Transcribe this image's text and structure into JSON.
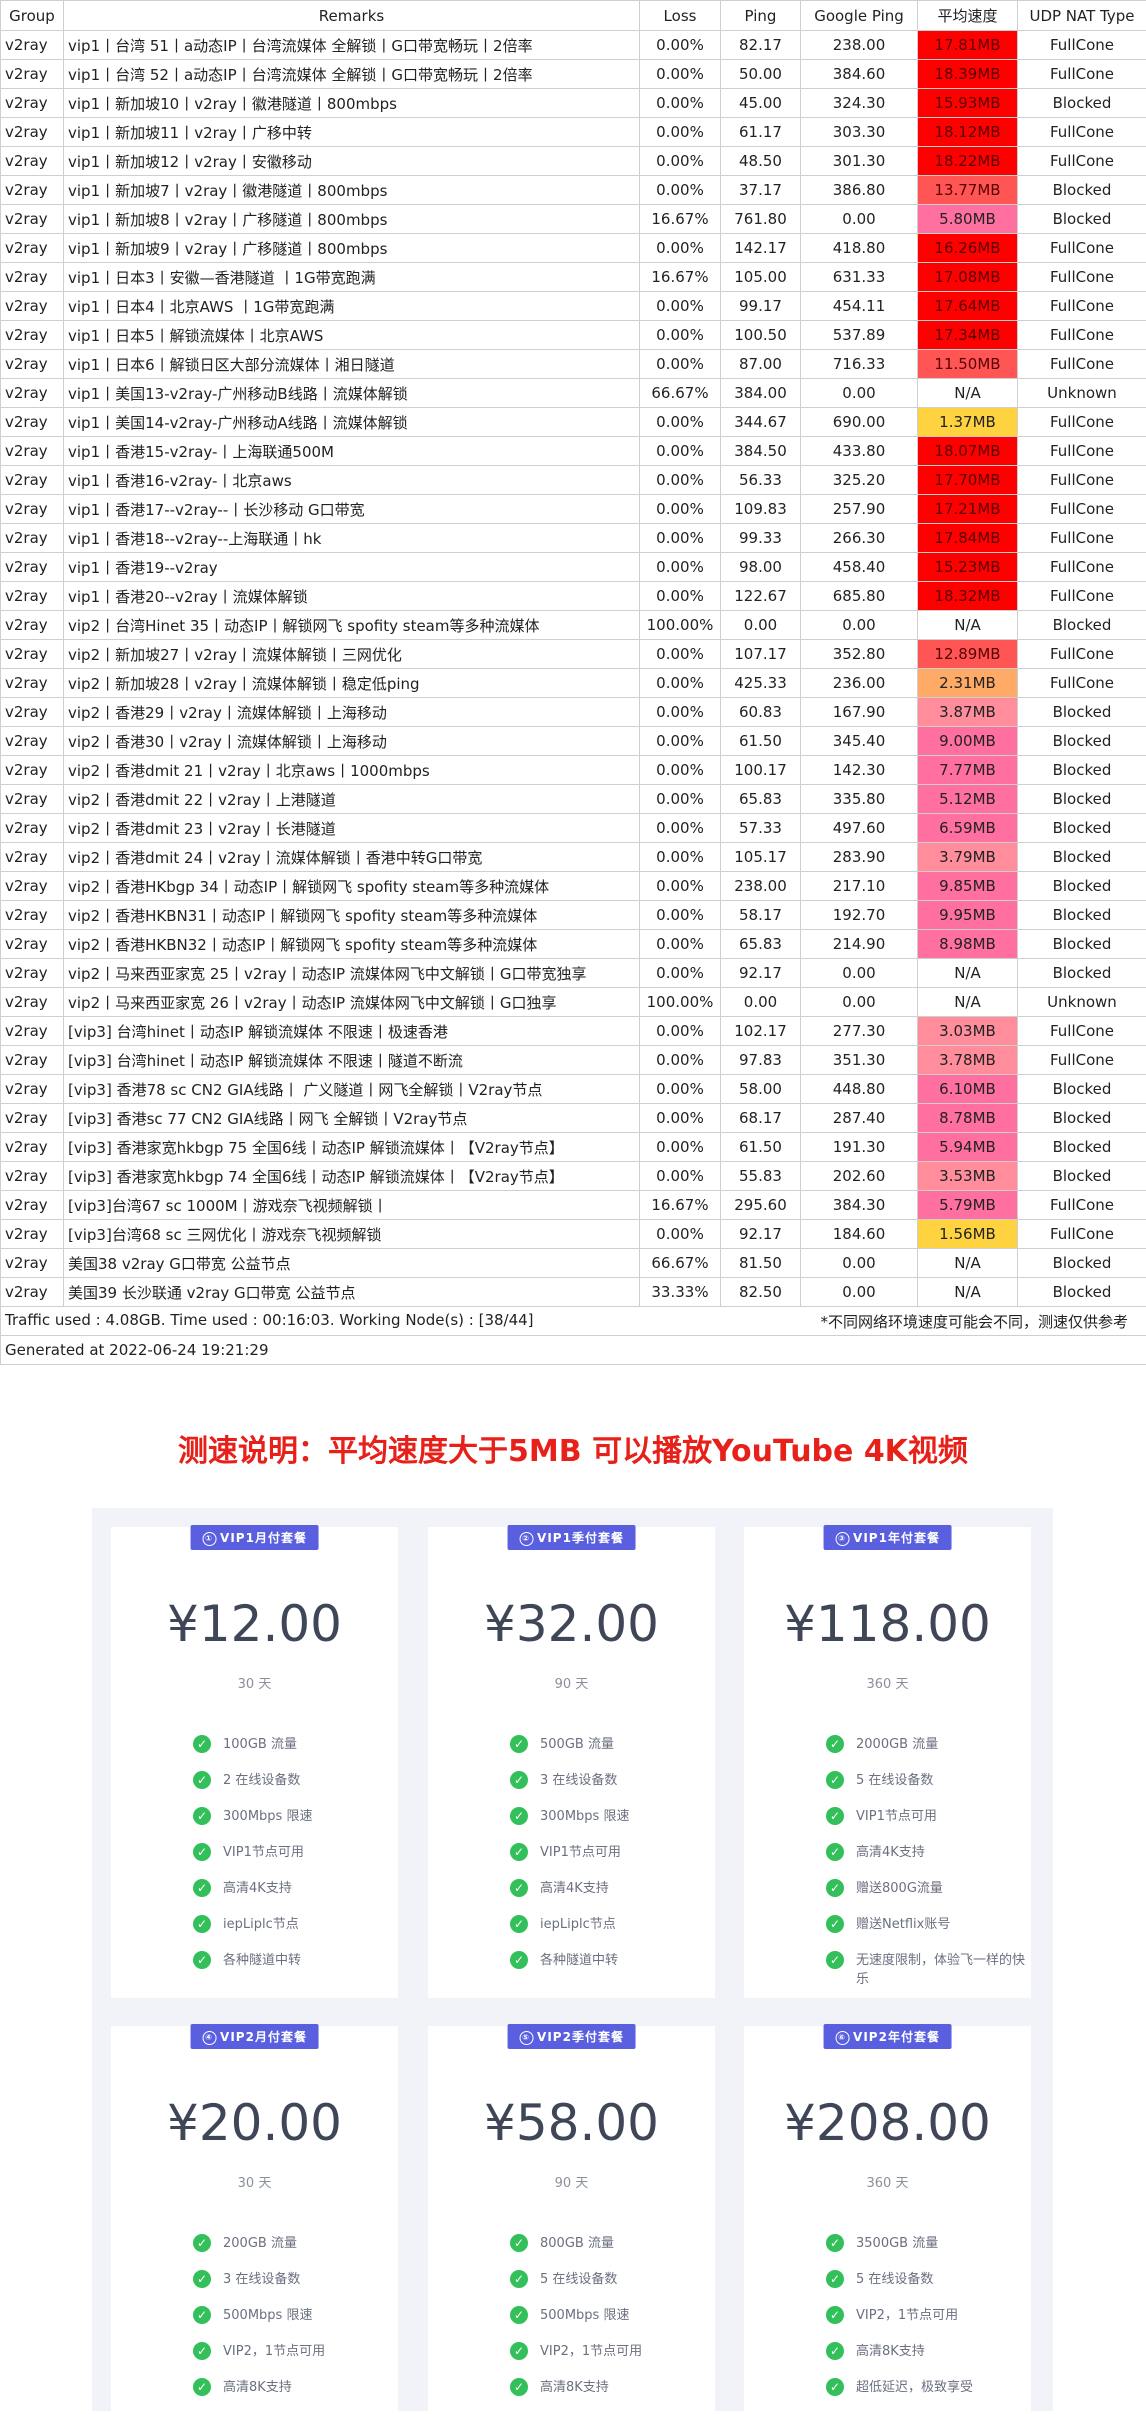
{
  "table": {
    "headers": [
      "Group",
      "Remarks",
      "Loss",
      "Ping",
      "Google Ping",
      "平均速度",
      "UDP NAT Type"
    ],
    "rows": [
      [
        "v2ray",
        "vip1丨台湾 51丨a动态IP丨台湾流媒体 全解锁丨G口带宽畅玩丨2倍率",
        "0.00%",
        "82.17",
        "238.00",
        "17.81MB",
        "FullCone"
      ],
      [
        "v2ray",
        "vip1丨台湾 52丨a动态IP丨台湾流媒体 全解锁丨G口带宽畅玩丨2倍率",
        "0.00%",
        "50.00",
        "384.60",
        "18.39MB",
        "FullCone"
      ],
      [
        "v2ray",
        "vip1丨新加坡10丨v2ray丨徽港隧道丨800mbps",
        "0.00%",
        "45.00",
        "324.30",
        "15.93MB",
        "Blocked"
      ],
      [
        "v2ray",
        "vip1丨新加坡11丨v2ray丨广移中转",
        "0.00%",
        "61.17",
        "303.30",
        "18.12MB",
        "FullCone"
      ],
      [
        "v2ray",
        "vip1丨新加坡12丨v2ray丨安徽移动",
        "0.00%",
        "48.50",
        "301.30",
        "18.22MB",
        "FullCone"
      ],
      [
        "v2ray",
        "vip1丨新加坡7丨v2ray丨徽港隧道丨800mbps",
        "0.00%",
        "37.17",
        "386.80",
        "13.77MB",
        "Blocked"
      ],
      [
        "v2ray",
        "vip1丨新加坡8丨v2ray丨广移隧道丨800mbps",
        "16.67%",
        "761.80",
        "0.00",
        "5.80MB",
        "Blocked"
      ],
      [
        "v2ray",
        "vip1丨新加坡9丨v2ray丨广移隧道丨800mbps",
        "0.00%",
        "142.17",
        "418.80",
        "16.26MB",
        "FullCone"
      ],
      [
        "v2ray",
        "vip1丨日本3丨安徽—香港隧道 丨1G带宽跑满",
        "16.67%",
        "105.00",
        "631.33",
        "17.08MB",
        "FullCone"
      ],
      [
        "v2ray",
        "vip1丨日本4丨北京AWS 丨1G带宽跑满",
        "0.00%",
        "99.17",
        "454.11",
        "17.64MB",
        "FullCone"
      ],
      [
        "v2ray",
        "vip1丨日本5丨解锁流媒体丨北京AWS",
        "0.00%",
        "100.50",
        "537.89",
        "17.34MB",
        "FullCone"
      ],
      [
        "v2ray",
        "vip1丨日本6丨解锁日区大部分流媒体丨湘日隧道",
        "0.00%",
        "87.00",
        "716.33",
        "11.50MB",
        "FullCone"
      ],
      [
        "v2ray",
        "vip1丨美国13-v2ray-广州移动B线路丨流媒体解锁",
        "66.67%",
        "384.00",
        "0.00",
        "N/A",
        "Unknown"
      ],
      [
        "v2ray",
        "vip1丨美国14-v2ray-广州移动A线路丨流媒体解锁",
        "0.00%",
        "344.67",
        "690.00",
        "1.37MB",
        "FullCone"
      ],
      [
        "v2ray",
        "vip1丨香港15-v2ray-丨上海联通500M",
        "0.00%",
        "384.50",
        "433.80",
        "18.07MB",
        "FullCone"
      ],
      [
        "v2ray",
        "vip1丨香港16-v2ray-丨北京aws",
        "0.00%",
        "56.33",
        "325.20",
        "17.70MB",
        "FullCone"
      ],
      [
        "v2ray",
        "vip1丨香港17--v2ray--丨长沙移动 G口带宽",
        "0.00%",
        "109.83",
        "257.90",
        "17.21MB",
        "FullCone"
      ],
      [
        "v2ray",
        "vip1丨香港18--v2ray--上海联通丨hk",
        "0.00%",
        "99.33",
        "266.30",
        "17.84MB",
        "FullCone"
      ],
      [
        "v2ray",
        "vip1丨香港19--v2ray",
        "0.00%",
        "98.00",
        "458.40",
        "15.23MB",
        "FullCone"
      ],
      [
        "v2ray",
        "vip1丨香港20--v2ray丨流媒体解锁",
        "0.00%",
        "122.67",
        "685.80",
        "18.32MB",
        "FullCone"
      ],
      [
        "v2ray",
        "vip2丨台湾Hinet 35丨动态IP丨解锁网飞 spofity steam等多种流媒体",
        "100.00%",
        "0.00",
        "0.00",
        "N/A",
        "Blocked"
      ],
      [
        "v2ray",
        "vip2丨新加坡27丨v2ray丨流媒体解锁丨三网优化",
        "0.00%",
        "107.17",
        "352.80",
        "12.89MB",
        "FullCone"
      ],
      [
        "v2ray",
        "vip2丨新加坡28丨v2ray丨流媒体解锁丨稳定低ping",
        "0.00%",
        "425.33",
        "236.00",
        "2.31MB",
        "FullCone"
      ],
      [
        "v2ray",
        "vip2丨香港29丨v2ray丨流媒体解锁丨上海移动",
        "0.00%",
        "60.83",
        "167.90",
        "3.87MB",
        "Blocked"
      ],
      [
        "v2ray",
        "vip2丨香港30丨v2ray丨流媒体解锁丨上海移动",
        "0.00%",
        "61.50",
        "345.40",
        "9.00MB",
        "Blocked"
      ],
      [
        "v2ray",
        "vip2丨香港dmit 21丨v2ray丨北京aws丨1000mbps",
        "0.00%",
        "100.17",
        "142.30",
        "7.77MB",
        "Blocked"
      ],
      [
        "v2ray",
        "vip2丨香港dmit 22丨v2ray丨上港隧道",
        "0.00%",
        "65.83",
        "335.80",
        "5.12MB",
        "Blocked"
      ],
      [
        "v2ray",
        "vip2丨香港dmit 23丨v2ray丨长港隧道",
        "0.00%",
        "57.33",
        "497.60",
        "6.59MB",
        "Blocked"
      ],
      [
        "v2ray",
        "vip2丨香港dmit 24丨v2ray丨流媒体解锁丨香港中转G口带宽",
        "0.00%",
        "105.17",
        "283.90",
        "3.79MB",
        "Blocked"
      ],
      [
        "v2ray",
        "vip2丨香港HKbgp 34丨动态IP丨解锁网飞 spofity steam等多种流媒体",
        "0.00%",
        "238.00",
        "217.10",
        "9.85MB",
        "Blocked"
      ],
      [
        "v2ray",
        "vip2丨香港HKBN31丨动态IP丨解锁网飞 spofity steam等多种流媒体",
        "0.00%",
        "58.17",
        "192.70",
        "9.95MB",
        "Blocked"
      ],
      [
        "v2ray",
        "vip2丨香港HKBN32丨动态IP丨解锁网飞 spofity steam等多种流媒体",
        "0.00%",
        "65.83",
        "214.90",
        "8.98MB",
        "Blocked"
      ],
      [
        "v2ray",
        "vip2丨马来西亚家宽 25丨v2ray丨动态IP 流媒体网飞中文解锁丨G口带宽独享",
        "0.00%",
        "92.17",
        "0.00",
        "N/A",
        "Blocked"
      ],
      [
        "v2ray",
        "vip2丨马来西亚家宽 26丨v2ray丨动态IP 流媒体网飞中文解锁丨G口独享",
        "100.00%",
        "0.00",
        "0.00",
        "N/A",
        "Unknown"
      ],
      [
        "v2ray",
        "[vip3] 台湾hinet丨动态IP 解锁流媒体 不限速丨极速香港",
        "0.00%",
        "102.17",
        "277.30",
        "3.03MB",
        "FullCone"
      ],
      [
        "v2ray",
        "[vip3] 台湾hinet丨动态IP 解锁流媒体 不限速丨隧道不断流",
        "0.00%",
        "97.83",
        "351.30",
        "3.78MB",
        "FullCone"
      ],
      [
        "v2ray",
        "[vip3] 香港78 sc CN2 GIA线路丨 广义隧道丨网飞全解锁丨V2ray节点",
        "0.00%",
        "58.00",
        "448.80",
        "6.10MB",
        "Blocked"
      ],
      [
        "v2ray",
        "[vip3] 香港sc 77 CN2 GIA线路丨网飞 全解锁丨V2ray节点",
        "0.00%",
        "68.17",
        "287.40",
        "8.78MB",
        "Blocked"
      ],
      [
        "v2ray",
        "[vip3] 香港家宽hkbgp 75 全国6线丨动态IP 解锁流媒体丨【V2ray节点】",
        "0.00%",
        "61.50",
        "191.30",
        "5.94MB",
        "Blocked"
      ],
      [
        "v2ray",
        "[vip3] 香港家宽hkbgp 74 全国6线丨动态IP 解锁流媒体丨【V2ray节点】",
        "0.00%",
        "55.83",
        "202.60",
        "3.53MB",
        "Blocked"
      ],
      [
        "v2ray",
        "[vip3]台湾67 sc 1000M丨游戏奈飞视频解锁丨",
        "16.67%",
        "295.60",
        "384.30",
        "5.79MB",
        "FullCone"
      ],
      [
        "v2ray",
        "[vip3]台湾68 sc 三网优化丨游戏奈飞视频解锁",
        "0.00%",
        "92.17",
        "184.60",
        "1.56MB",
        "FullCone"
      ],
      [
        "v2ray",
        "美国38 v2ray G口带宽 公益节点",
        "66.67%",
        "81.50",
        "0.00",
        "N/A",
        "Blocked"
      ],
      [
        "v2ray",
        "美国39 长沙联通 v2ray G口带宽 公益节点",
        "33.33%",
        "82.50",
        "0.00",
        "N/A",
        "Blocked"
      ]
    ],
    "traffic_text": "Traffic used : 4.08GB. Time used : 00:16:03. Working Node(s) : [38/44]",
    "disclaimer": "*不同网络环境速度可能会不同，测速仅供参考",
    "generated_text": "Generated at 2022-06-24 19:21:29"
  },
  "speed_colors": {
    "very_high": "#ff0000",
    "high": "#ff5555",
    "medium": "#ff6f9f",
    "low_mid": "#ff8d9b",
    "orange": "#ffaa66",
    "low": "#ffd23f",
    "none": "#ffffff"
  },
  "headline": "测速说明：平均速度大于5MB 可以播放YouTube 4K视频",
  "plans": [
    {
      "badge": "VIP1月付套餐",
      "num": "①",
      "price": "¥12.00",
      "period": "30 天",
      "features": [
        "100GB 流量",
        "2 在线设备数",
        "300Mbps 限速",
        "VIP1节点可用",
        "高清4K支持",
        "iepLiplc节点",
        "各种隧道中转"
      ]
    },
    {
      "badge": "VIP1季付套餐",
      "num": "②",
      "price": "¥32.00",
      "period": "90 天",
      "features": [
        "500GB 流量",
        "3 在线设备数",
        "300Mbps 限速",
        "VIP1节点可用",
        "高清4K支持",
        "iepLiplc节点",
        "各种隧道中转"
      ]
    },
    {
      "badge": "VIP1年付套餐",
      "num": "③",
      "price": "¥118.00",
      "period": "360 天",
      "features": [
        "2000GB 流量",
        "5 在线设备数",
        "VIP1节点可用",
        "高清4K支持",
        "赠送800G流量",
        "赠送Netflix账号",
        "无速度限制，体验飞一样的快乐"
      ]
    },
    {
      "badge": "VIP2月付套餐",
      "num": "④",
      "price": "¥20.00",
      "period": "30 天",
      "features": [
        "200GB 流量",
        "3 在线设备数",
        "500Mbps 限速",
        "VIP2，1节点可用",
        "高清8K支持"
      ]
    },
    {
      "badge": "VIP2季付套餐",
      "num": "⑤",
      "price": "¥58.00",
      "period": "90 天",
      "features": [
        "800GB 流量",
        "5 在线设备数",
        "500Mbps 限速",
        "VIP2，1节点可用",
        "高清8K支持"
      ]
    },
    {
      "badge": "VIP2年付套餐",
      "num": "⑥",
      "price": "¥208.00",
      "period": "360 天",
      "features": [
        "3500GB 流量",
        "5 在线设备数",
        "VIP2，1节点可用",
        "高清8K支持",
        "超低延迟，极致享受"
      ]
    }
  ],
  "icons": {
    "check": "check-icon"
  }
}
